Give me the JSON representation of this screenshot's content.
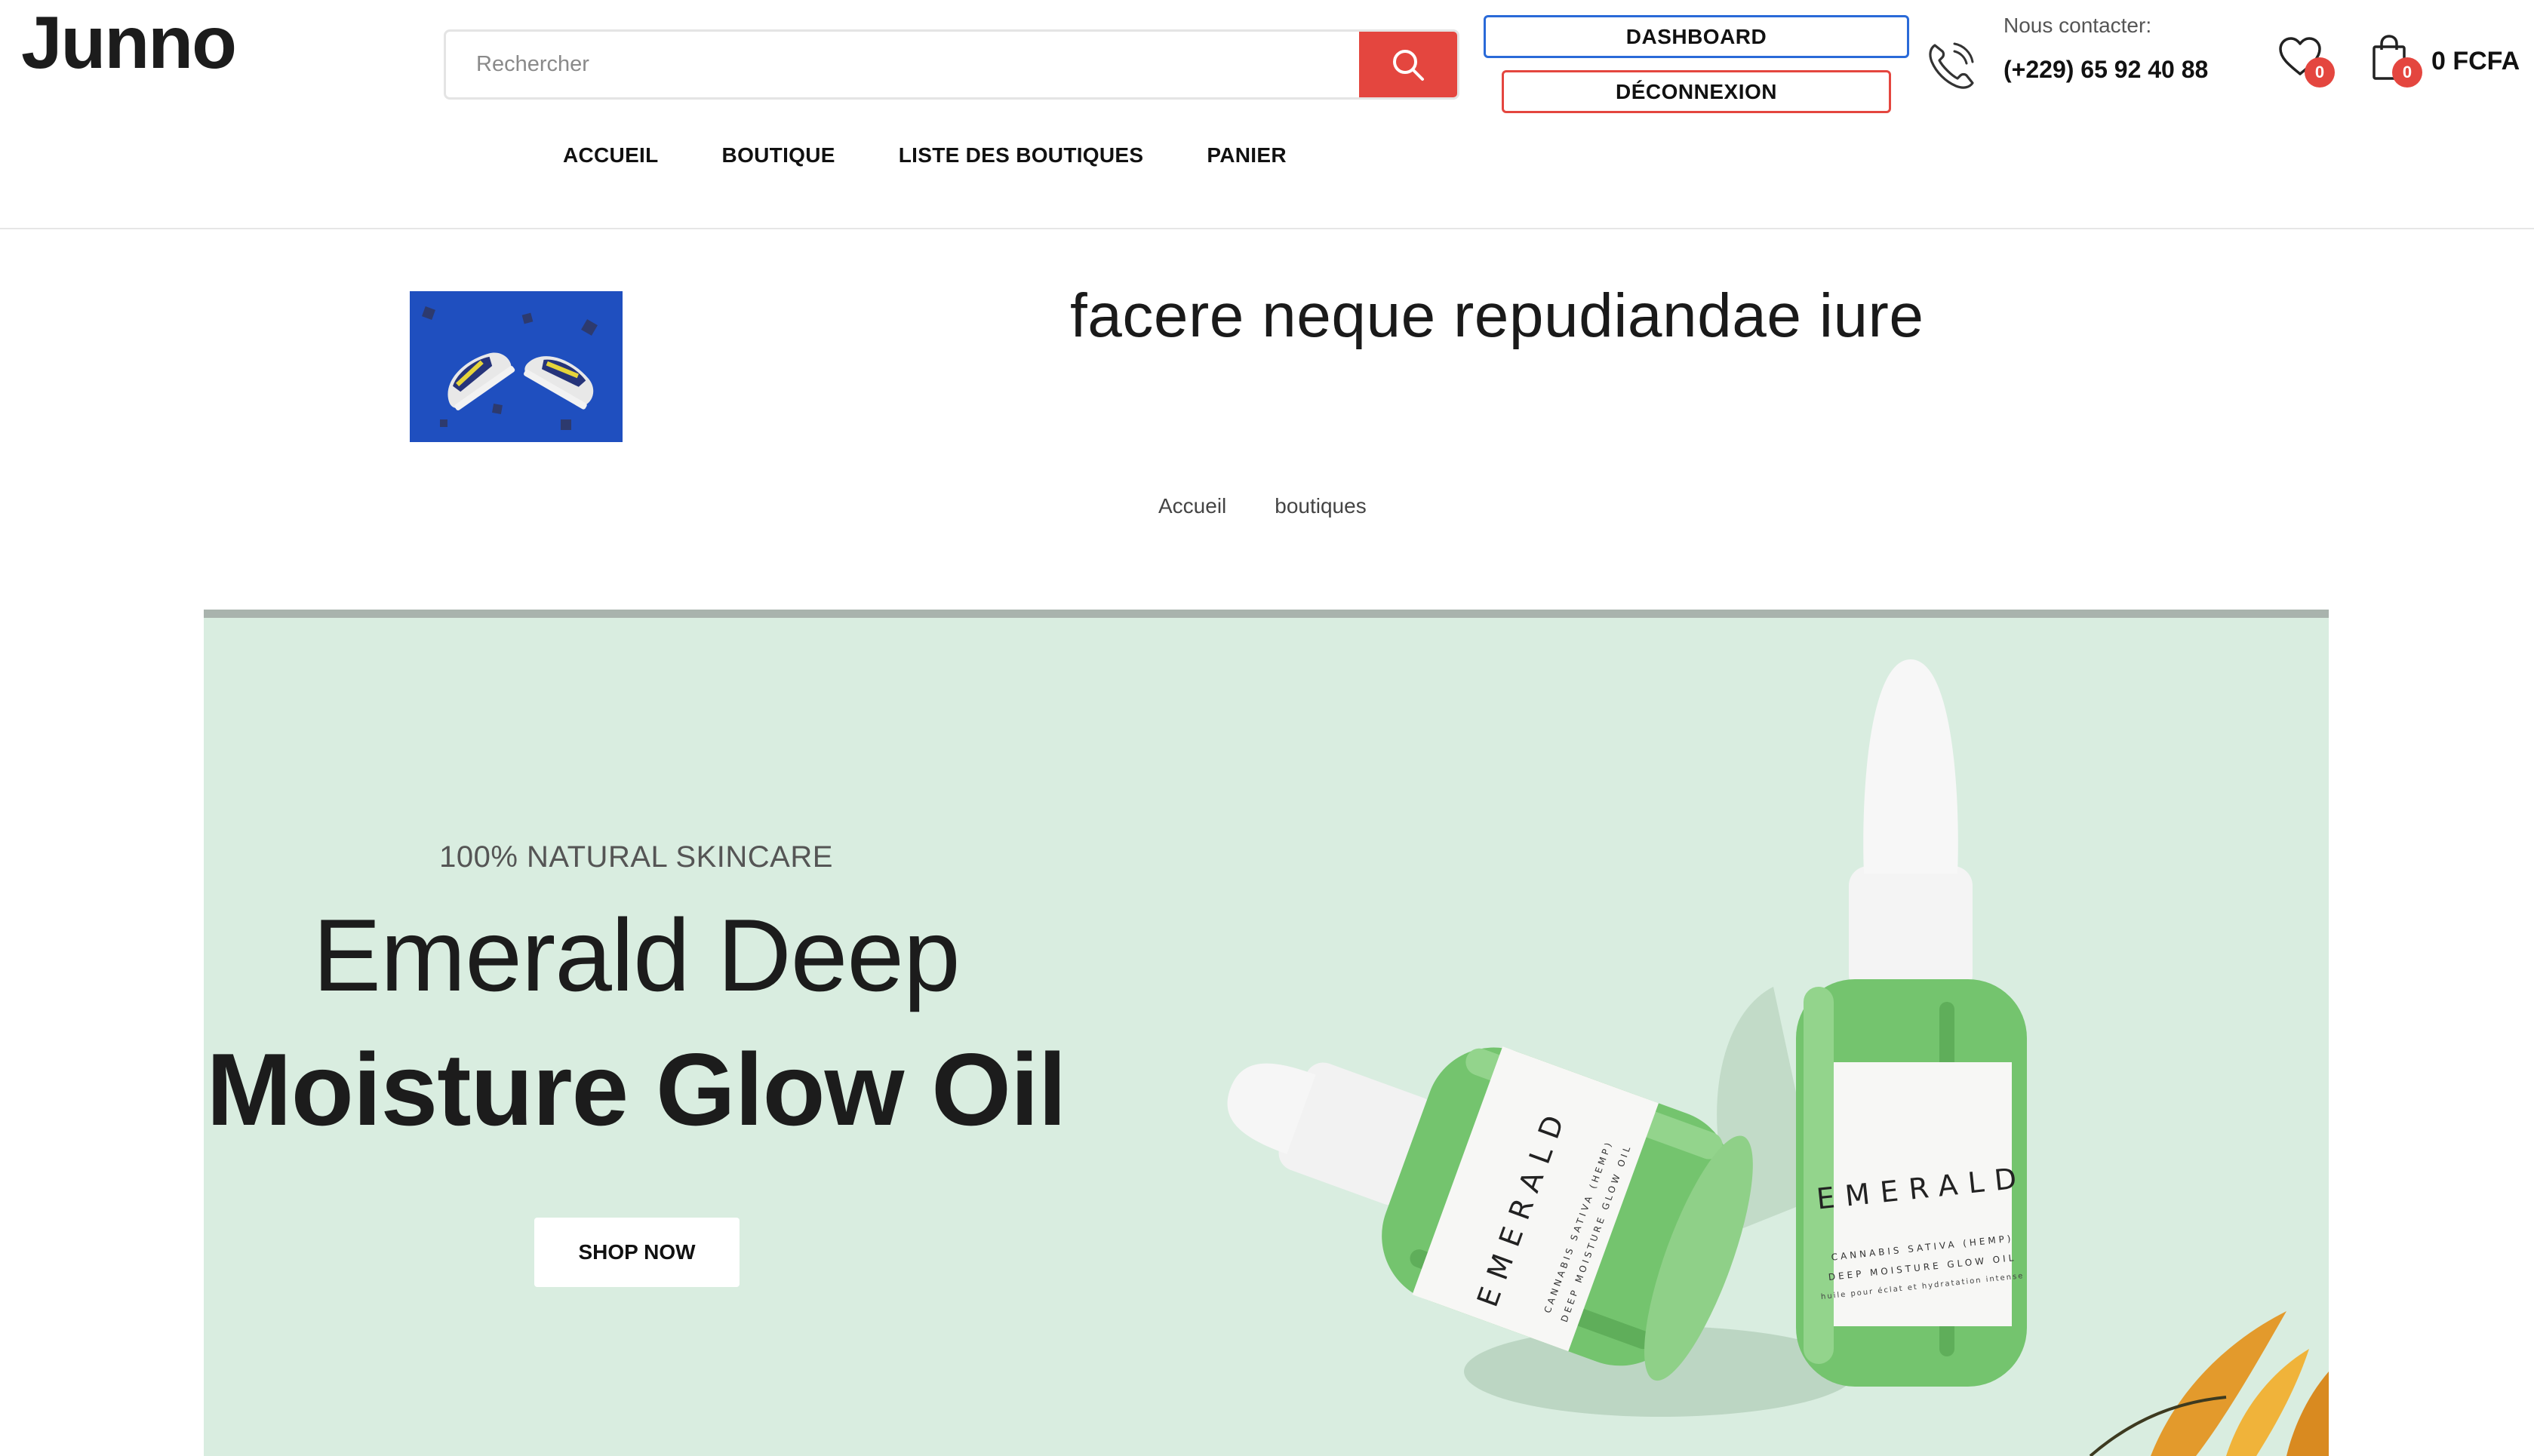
{
  "brand": {
    "logo_text": "Junno"
  },
  "search": {
    "placeholder": "Rechercher"
  },
  "account": {
    "dashboard_label": "DASHBOARD",
    "logout_label": "DÉCONNEXION"
  },
  "contact": {
    "label": "Nous contacter:",
    "phone": "(+229) 65 92 40 88"
  },
  "wishlist": {
    "count": "0"
  },
  "cart": {
    "count": "0",
    "total": "0 FCFA"
  },
  "nav": {
    "items": [
      {
        "label": "ACCUEIL"
      },
      {
        "label": "BOUTIQUE"
      },
      {
        "label": "LISTE DES BOUTIQUES"
      },
      {
        "label": "PANIER"
      }
    ]
  },
  "shop": {
    "name": "facere neque repudiandae iure"
  },
  "breadcrumb": {
    "items": [
      {
        "label": "Accueil"
      },
      {
        "label": "boutiques"
      }
    ]
  },
  "banner": {
    "eyebrow": "100% NATURAL SKINCARE",
    "title_line1": "Emerald Deep",
    "title_line2": "Moisture Glow Oil",
    "cta_label": "SHOP NOW",
    "bottle_brand": "EMERALD",
    "bottle_subtitle_1": "CANNABIS SATIVA (HEMP)",
    "bottle_subtitle_2": "DEEP MOISTURE GLOW OIL",
    "bottle_subtitle_3": "huile pour éclat et hydratation intense"
  },
  "colors": {
    "accent_red": "#e4463f",
    "accent_blue": "#2a6ad8",
    "banner_bg": "#d9ede0",
    "bottle_green": "#6fbf6a"
  },
  "icons": {
    "search": "search-icon",
    "phone": "phone-icon",
    "wishlist": "heart-icon",
    "cart": "shopping-bag-icon"
  }
}
